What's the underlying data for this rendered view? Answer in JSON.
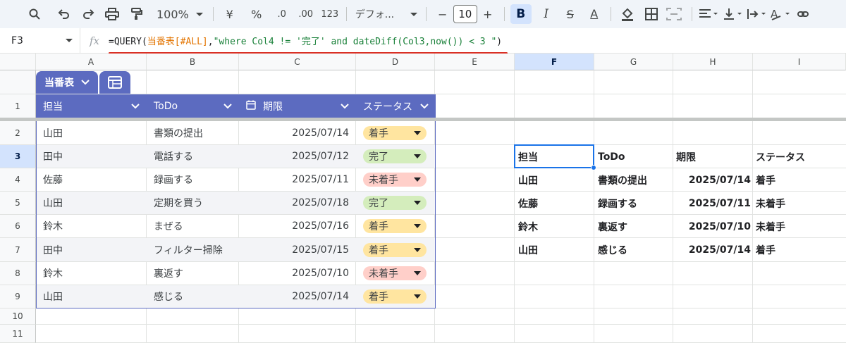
{
  "toolbar": {
    "zoom": "100%",
    "currency": "¥",
    "percent": "%",
    "decrease_decimal": ".0",
    "increase_decimal": ".00",
    "number_format": "123",
    "font_name": "デフォ...",
    "font_size": "10",
    "minus": "−",
    "plus": "+",
    "bold": "B",
    "italic": "I",
    "strike": "S",
    "textcolor": "A"
  },
  "formula_bar": {
    "cell_ref": "F3",
    "fx": "fx",
    "f1": "=QUERY(",
    "f2": "当番表[#ALL]",
    "f3": ",",
    "f4": "\"where Col4 != '完了' and dateDiff(Col3,now()) < 3 \"",
    "f5": ")"
  },
  "columns": [
    "A",
    "B",
    "C",
    "D",
    "E",
    "F",
    "G",
    "H",
    "I"
  ],
  "rows": [
    "1",
    "2",
    "3",
    "4",
    "5",
    "6",
    "7",
    "8",
    "9",
    "10",
    "11"
  ],
  "table": {
    "name": "当番表",
    "headers": [
      "担当",
      "ToDo",
      "期限",
      "ステータス"
    ],
    "rows": [
      {
        "person": "山田",
        "todo": "書類の提出",
        "due": "2025/07/14",
        "status": "着手"
      },
      {
        "person": "田中",
        "todo": "電話する",
        "due": "2025/07/12",
        "status": "完了"
      },
      {
        "person": "佐藤",
        "todo": "録画する",
        "due": "2025/07/11",
        "status": "未着手"
      },
      {
        "person": "山田",
        "todo": "定期を買う",
        "due": "2025/07/18",
        "status": "完了"
      },
      {
        "person": "鈴木",
        "todo": "まぜる",
        "due": "2025/07/16",
        "status": "着手"
      },
      {
        "person": "田中",
        "todo": "フィルター掃除",
        "due": "2025/07/15",
        "status": "着手"
      },
      {
        "person": "鈴木",
        "todo": "裏返す",
        "due": "2025/07/10",
        "status": "未着手"
      },
      {
        "person": "山田",
        "todo": "感じる",
        "due": "2025/07/14",
        "status": "着手"
      }
    ]
  },
  "status_colors": {
    "着手": "#ffe5a0",
    "完了": "#d4edbc",
    "未着手": "#ffcfc9"
  },
  "accent": "#5c6bc0",
  "query_result": {
    "headers": [
      "担当",
      "ToDo",
      "期限",
      "ステータス"
    ],
    "rows": [
      {
        "person": "山田",
        "todo": "書類の提出",
        "due": "2025/07/14",
        "status": "着手"
      },
      {
        "person": "佐藤",
        "todo": "録画する",
        "due": "2025/07/11",
        "status": "未着手"
      },
      {
        "person": "鈴木",
        "todo": "裏返す",
        "due": "2025/07/10",
        "status": "未着手"
      },
      {
        "person": "山田",
        "todo": "感じる",
        "due": "2025/07/14",
        "status": "着手"
      }
    ]
  }
}
